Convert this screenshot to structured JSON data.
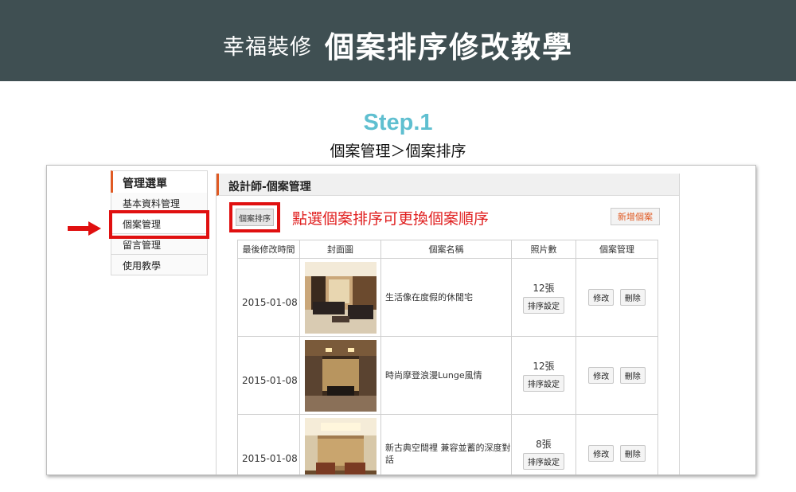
{
  "banner": {
    "brand": "幸福裝修",
    "title": "個案排序修改教學"
  },
  "step": {
    "label": "Step.1",
    "path": "個案管理＞個案排序"
  },
  "sidebar": {
    "heading": "管理選單",
    "items": [
      {
        "label": "基本資料管理"
      },
      {
        "label": "個案管理"
      },
      {
        "label": "留言管理"
      },
      {
        "label": "使用教學"
      }
    ]
  },
  "panel": {
    "heading": "設計師-個案管理",
    "sort_button": "個案排序",
    "instruction": "點選個案排序可更換個案順序",
    "add_button": "新增個案"
  },
  "table": {
    "headers": [
      "最後修改時間",
      "封面圖",
      "個案名稱",
      "照片數",
      "個案管理"
    ],
    "rows": [
      {
        "date": "2015-01-08",
        "name": "生活像在度假的休閒宅",
        "count": "12張",
        "sort": "排序設定",
        "edit": "修改",
        "delete": "刪除"
      },
      {
        "date": "2015-01-08",
        "name": "時尚摩登浪漫Lunge風情",
        "count": "12張",
        "sort": "排序設定",
        "edit": "修改",
        "delete": "刪除"
      },
      {
        "date": "2015-01-08",
        "name": "新古典空間裡 兼容並蓄的深度對話",
        "count": "8張",
        "sort": "排序設定",
        "edit": "修改",
        "delete": "刪除"
      }
    ]
  },
  "colors": {
    "banner": "#3f4f52",
    "step": "#5fbfd0",
    "highlight": "#e01010",
    "accent": "#e05a23"
  }
}
